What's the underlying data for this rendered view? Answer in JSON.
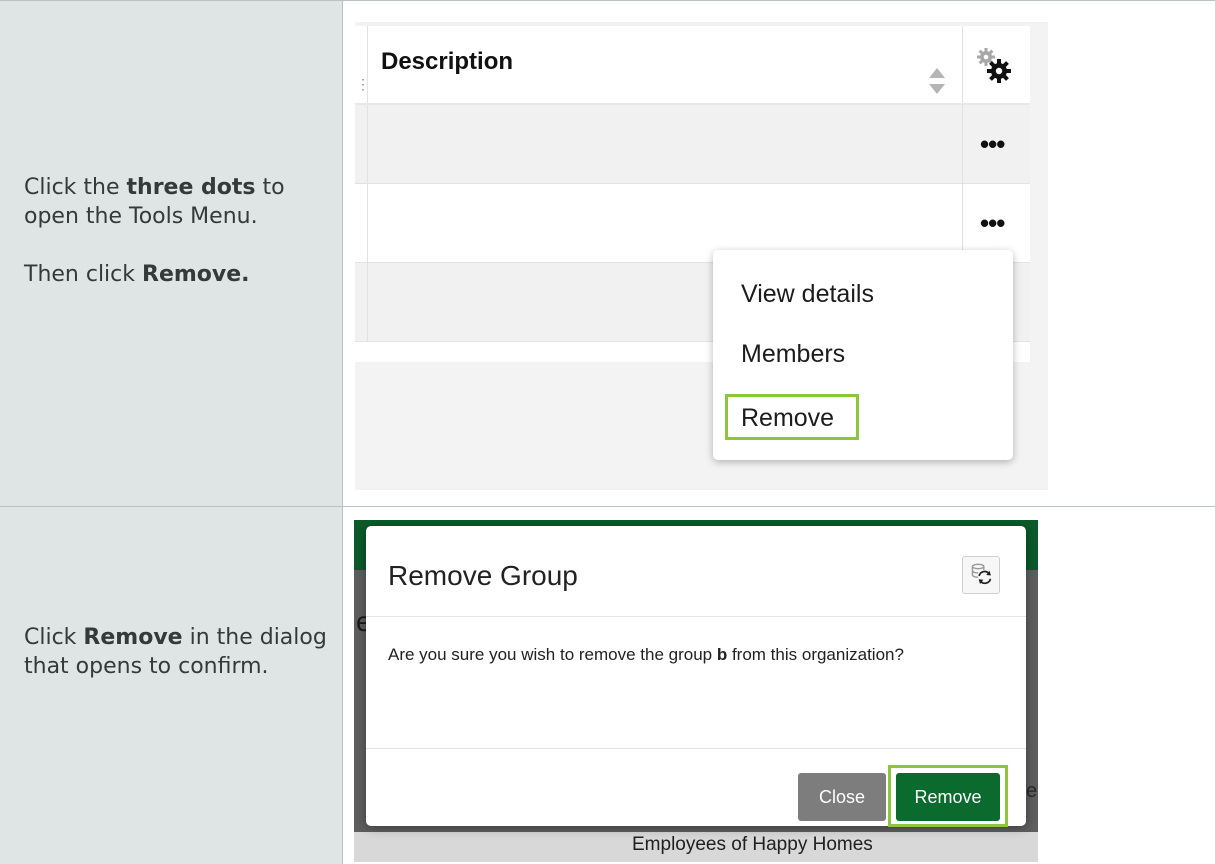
{
  "steps": [
    {
      "instruction": {
        "l1_pre": "Click the ",
        "l1_bold": "three dots",
        "l1_post": " to open the Tools Menu.",
        "l2_pre": "Then click ",
        "l2_bold": "Remove."
      },
      "screenshot": {
        "column_header": "Description",
        "row_action_label": "•••",
        "menu_items": [
          "View details",
          "Members",
          "Remove"
        ],
        "highlight_color": "#8cc63f"
      }
    },
    {
      "instruction": {
        "l1_pre": "Click ",
        "l1_bold": "Remove",
        "l1_post": " in the dialog that opens to confirm."
      },
      "screenshot": {
        "dialog_title": "Remove Group",
        "message_pre": "Are you sure you wish to remove the group ",
        "message_group": "b",
        "message_post": " from this organization?",
        "close_label": "Close",
        "remove_label": "Remove",
        "background_partial_text": "Employees of Happy Homes",
        "brand_color": "#0b6b2e",
        "highlight_color": "#8cc63f"
      }
    }
  ]
}
